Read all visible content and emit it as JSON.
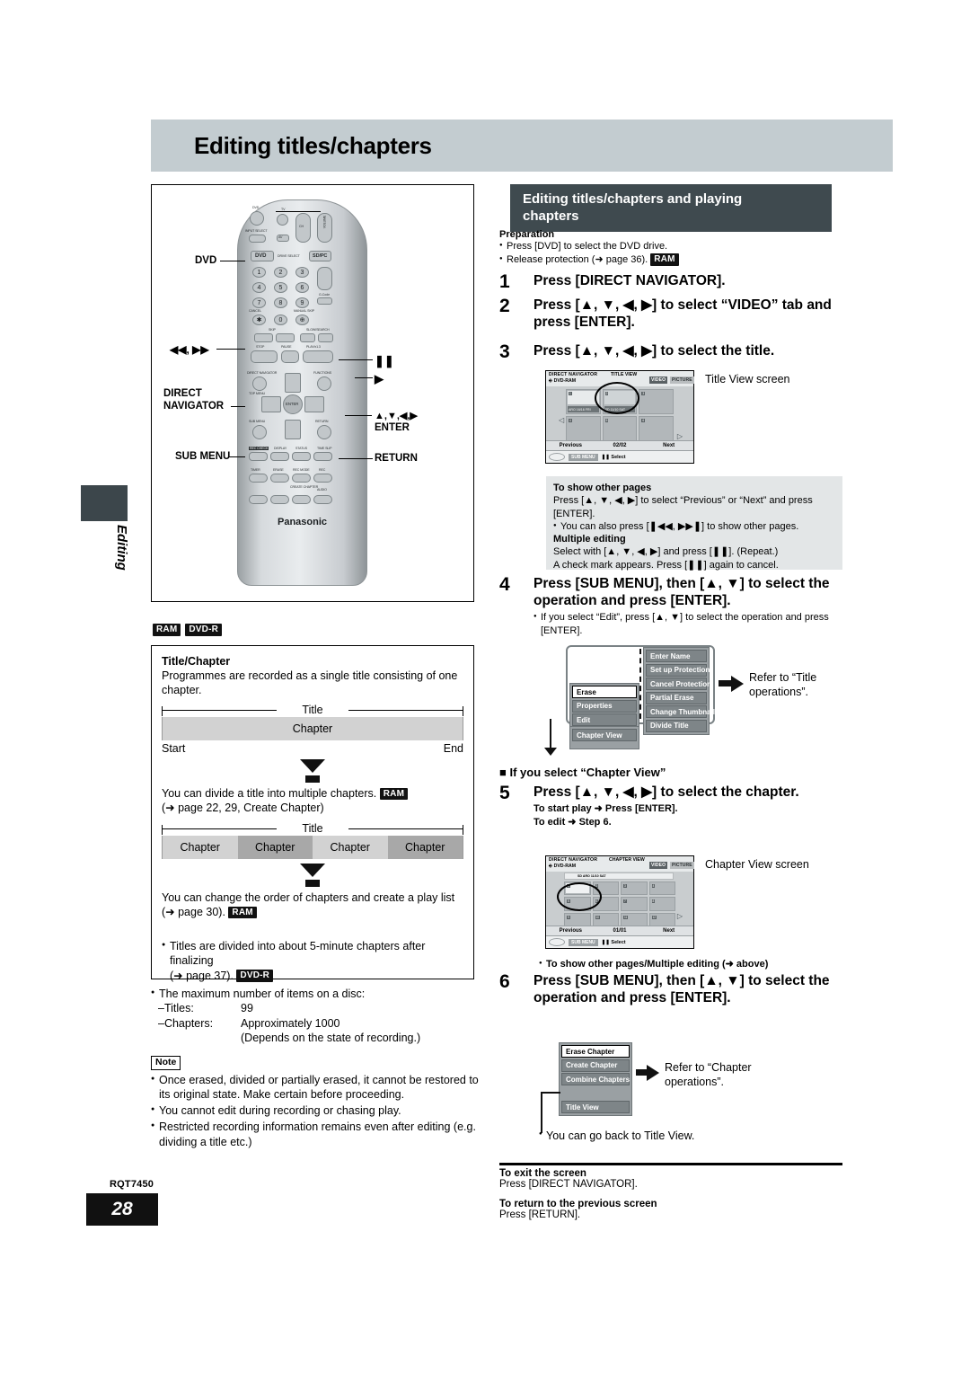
{
  "page": {
    "header_title": "Editing titles/chapters",
    "side_tab_label": "Editing",
    "footer_code": "RQT7450",
    "footer_page": "28"
  },
  "remote": {
    "brand": "Panasonic",
    "callouts": {
      "dvd": "DVD",
      "skip": "◀◀, ▶▶",
      "direct_navigator_l1": "DIRECT",
      "direct_navigator_l2": "NAVIGATOR",
      "sub_menu": "SUB MENU",
      "pause": "❚❚",
      "play": "▶",
      "cursor": "▲,▼,◀,▶",
      "enter": "ENTER",
      "return": "RETURN"
    },
    "labels": {
      "dvd_top": "DVD",
      "tv": "TV",
      "input_select": "INPUT SELECT",
      "av": "AV",
      "ch": "CH",
      "volume": "VOLUME",
      "drive_select": "DRIVE SELECT",
      "dvd_btn": "DVD",
      "sd_pc": "SD/PC",
      "g_code": "G-Code",
      "cancel": "CANCEL",
      "manual_skip": "MANUAL SKIP",
      "skip": "SKIP",
      "slow_search": "SLOW/SEARCH",
      "stop": "STOP",
      "pause": "PAUSE",
      "play": "PLAY/x1.3",
      "direct_navigator": "DIRECT NAVIGATOR",
      "top_menu": "TOP MENU",
      "functions": "FUNCTIONS",
      "enter": "ENTER",
      "sub_menu": "SUB MENU",
      "return": "RETURN",
      "rec_check": "REC CHECK",
      "display": "DISPLAY",
      "status": "STATUS",
      "time_slip": "TIME SLIP",
      "timer": "TIMER",
      "erase": "ERASE",
      "rec_mode": "REC MODE",
      "rec": "REC",
      "create_chapter": "CREATE CHAPTER",
      "audio": "AUDIO",
      "numbers": [
        "1",
        "2",
        "3",
        "4",
        "5",
        "6",
        "7",
        "8",
        "9",
        "0"
      ]
    }
  },
  "media_badges": {
    "ram": "RAM",
    "dvdr": "DVD-R"
  },
  "title_chapter": {
    "heading": "Title/Chapter",
    "intro": "Programmes are recorded as a single title consisting of one chapter.",
    "diagram1": {
      "title_label": "Title",
      "chapters": [
        "Chapter"
      ],
      "start": "Start",
      "end": "End"
    },
    "divide_text": "You can divide a title into multiple chapters.",
    "divide_ref": "(➜ page 22, 29, Create Chapter)",
    "diagram2": {
      "title_label": "Title",
      "chapters": [
        "Chapter",
        "Chapter",
        "Chapter",
        "Chapter"
      ]
    },
    "playlist_text": "You can change the order of chapters and create a play list",
    "playlist_ref": "(➜ page 30).",
    "finalize_text": "Titles are divided into about 5-minute chapters after finalizing",
    "finalize_ref": "(➜ page 37).",
    "max_heading": "The maximum number of items on a disc:",
    "max_rows": [
      {
        "label": "–Titles:",
        "value": "99"
      },
      {
        "label": "–Chapters:",
        "value": "Approximately 1000"
      },
      {
        "label": "",
        "value": "(Depends on the state of recording.)"
      }
    ]
  },
  "note": {
    "label": "Note",
    "items": [
      "Once erased, divided or partially erased, it cannot be restored to its original state. Make certain before proceeding.",
      "You cannot edit during recording or chasing play.",
      "Restricted recording information remains even after editing (e.g. dividing a title etc.)"
    ]
  },
  "section": {
    "title_line1": "Editing titles/chapters and playing",
    "title_line2": "chapters",
    "preparation_heading": "Preparation",
    "preparation_items": [
      "Press [DVD] to select the DVD drive.",
      "Release protection (➜ page 36)."
    ],
    "preparation_badge": "RAM"
  },
  "steps": [
    {
      "num": "1",
      "text": "Press [DIRECT NAVIGATOR]."
    },
    {
      "num": "2",
      "text": "Press [▲, ▼, ◀, ▶] to select “VIDEO” tab and press [ENTER]."
    },
    {
      "num": "3",
      "text": "Press [▲, ▼, ◀, ▶] to select the title."
    },
    {
      "num": "4",
      "text": "Press [SUB MENU], then [▲, ▼] to select the operation and press [ENTER].",
      "sub": "If you select “Edit”, press [▲, ▼] to select the operation and press [ENTER]."
    },
    {
      "num": "5",
      "text": "Press [▲, ▼, ◀, ▶] to select the chapter.",
      "sub_a": "To start play ➜ Press [ENTER].",
      "sub_b": "To edit ➜ Step 6."
    },
    {
      "num": "6",
      "text": "Press [SUB MENU], then [▲, ▼] to select the operation and press [ENTER].",
      "sub": "You can go back to Title View."
    }
  ],
  "chapter_view_heading": "■ If you select “Chapter View”",
  "other_pages_note": "To show other pages/Multiple editing (➜ above)",
  "title_view_screen": {
    "caption": "Title View screen",
    "nav_label": "DIRECT NAVIGATOR",
    "disc_label": "DVD-RAM",
    "view_label": "TITLE VIEW",
    "tab_video": "VIDEO",
    "tab_picture": "PICTURE",
    "cells": [
      {
        "tag": "1",
        "capt": "ARO 16/16 FRI"
      },
      {
        "tag": "2",
        "capt": "SD 11/10 SAT"
      },
      {
        "tag": "3",
        "capt": ""
      },
      {
        "tag": "4",
        "capt": ""
      },
      {
        "tag": "5",
        "capt": ""
      },
      {
        "tag": "6",
        "capt": ""
      }
    ],
    "previous": "Previous",
    "page_indicator": "02/02",
    "next": "Next",
    "sub_menu": "SUB MENU",
    "select": "Select"
  },
  "chapter_view_screen": {
    "caption": "Chapter View screen",
    "nav_label": "DIRECT NAVIGATOR",
    "disc_label": "DVD-RAM",
    "view_label": "CHAPTER VIEW",
    "tab_video": "VIDEO",
    "tab_picture": "PICTURE",
    "title_bar": "SD ARO 11/10 SAT",
    "previous": "Previous",
    "page_indicator": "01/01",
    "next": "Next",
    "sub_menu": "SUB MENU",
    "select": "Select"
  },
  "info_box": {
    "h1": "To show other pages",
    "p1": "Press [▲, ▼, ◀, ▶] to select “Previous” or “Next” and press [ENTER].",
    "li1": "You can also press [❚◀◀, ▶▶❚] to show other pages.",
    "h2": "Multiple editing",
    "p2": "Select with [▲, ▼, ◀, ▶] and press [❚❚]. (Repeat.)",
    "p3": "A check mark appears. Press [❚❚] again to cancel."
  },
  "title_menu": {
    "main": [
      "Erase",
      "Properties",
      "Edit"
    ],
    "sub": [
      "Enter Name",
      "Set up Protection",
      "Cancel Protection",
      "Partial Erase",
      "Change Thumbnail",
      "Divide Title"
    ],
    "chapter_view": "Chapter View",
    "ref_line1": "Refer to “Title",
    "ref_line2": "operations”."
  },
  "chapter_menu": {
    "items": [
      "Erase Chapter",
      "Create Chapter",
      "Combine Chapters"
    ],
    "title_view": "Title View",
    "ref_line1": "Refer to “Chapter",
    "ref_line2": "operations”."
  },
  "exit": {
    "h1": "To exit the screen",
    "p1": "Press [DIRECT NAVIGATOR].",
    "h2": "To return to the previous screen",
    "p2": "Press [RETURN]."
  }
}
